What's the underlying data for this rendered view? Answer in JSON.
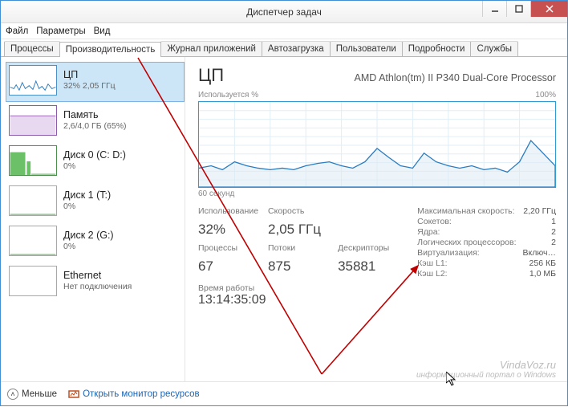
{
  "window": {
    "title": "Диспетчер задач"
  },
  "menu": {
    "file": "Файл",
    "options": "Параметры",
    "view": "Вид"
  },
  "tabs": {
    "processes": "Процессы",
    "performance": "Производительность",
    "apphistory": "Журнал приложений",
    "startup": "Автозагрузка",
    "users": "Пользователи",
    "details": "Подробности",
    "services": "Службы"
  },
  "sidebar": {
    "cpu": {
      "name": "ЦП",
      "sub": "32% 2,05 ГГц"
    },
    "mem": {
      "name": "Память",
      "sub": "2,6/4,0 ГБ (65%)"
    },
    "disk0": {
      "name": "Диск 0 (C: D:)",
      "sub": "0%"
    },
    "disk1": {
      "name": "Диск 1 (T:)",
      "sub": "0%"
    },
    "disk2": {
      "name": "Диск 2 (G:)",
      "sub": "0%"
    },
    "eth": {
      "name": "Ethernet",
      "sub": "Нет подключения"
    }
  },
  "main": {
    "title": "ЦП",
    "model": "AMD Athlon(tm) II P340 Dual-Core Processor",
    "chart_ylabel": "Используется %",
    "chart_ymax": "100%",
    "chart_xlabel": "60 секунд",
    "stats": {
      "use_lbl": "Использование",
      "use_val": "32%",
      "spd_lbl": "Скорость",
      "spd_val": "2,05 ГГц",
      "proc_lbl": "Процессы",
      "proc_val": "67",
      "thr_lbl": "Потоки",
      "thr_val": "875",
      "hnd_lbl": "Дескрипторы",
      "hnd_val": "35881",
      "up_lbl": "Время работы",
      "up_val": "13:14:35:09"
    },
    "details": {
      "maxspd_k": "Максимальная скорость:",
      "maxspd_v": "2,20 ГГц",
      "sock_k": "Сокетов:",
      "sock_v": "1",
      "cores_k": "Ядра:",
      "cores_v": "2",
      "lproc_k": "Логических процессоров:",
      "lproc_v": "2",
      "virt_k": "Виртуализация:",
      "virt_v": "Включ…",
      "l1_k": "Кэш L1:",
      "l1_v": "256 КБ",
      "l2_k": "Кэш L2:",
      "l2_v": "1,0 МБ"
    }
  },
  "footer": {
    "less": "Меньше",
    "openmon": "Открыть монитор ресурсов"
  },
  "watermark": {
    "line1": "VindaVoz.ru",
    "line2": "информационный портал о Windows"
  },
  "chart_data": {
    "type": "line",
    "title": "Используется %",
    "xlabel": "60 секунд",
    "ylabel": "%",
    "ylim": [
      0,
      100
    ],
    "x_seconds_ago": [
      60,
      58,
      56,
      54,
      52,
      50,
      48,
      46,
      44,
      42,
      40,
      38,
      36,
      34,
      32,
      30,
      28,
      26,
      24,
      22,
      20,
      18,
      16,
      14,
      12,
      10,
      8,
      6,
      4,
      2,
      0
    ],
    "values": [
      22,
      25,
      20,
      30,
      25,
      22,
      20,
      22,
      20,
      25,
      28,
      30,
      25,
      22,
      30,
      45,
      35,
      25,
      22,
      40,
      30,
      25,
      22,
      25,
      20,
      22,
      18,
      30,
      55,
      40,
      25
    ]
  }
}
